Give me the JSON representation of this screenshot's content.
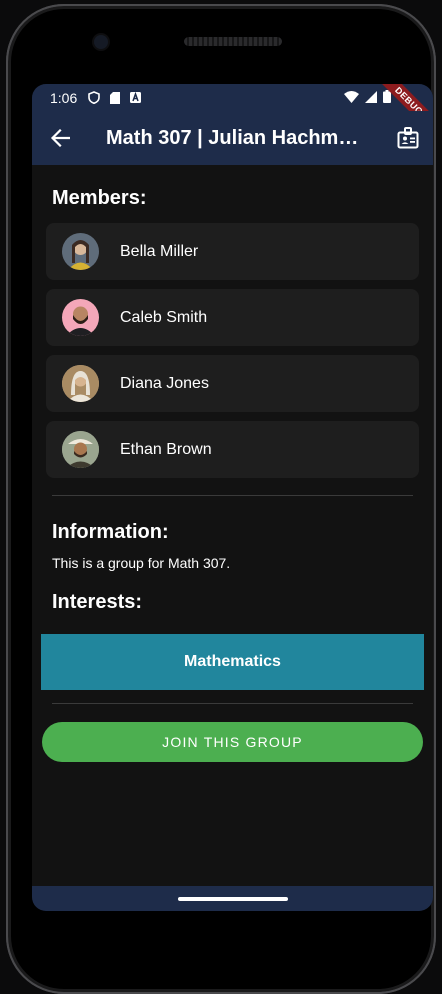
{
  "status_bar": {
    "time": "1:06",
    "debug_label": "DEBUG"
  },
  "app_bar": {
    "title": "Math 307 | Julian Hachme…"
  },
  "members": {
    "heading": "Members:",
    "items": [
      {
        "name": "Bella Miller",
        "avatar_color": "#6f7c8a"
      },
      {
        "name": "Caleb Smith",
        "avatar_color": "#f4a7b9"
      },
      {
        "name": "Diana Jones",
        "avatar_color": "#c9b08a"
      },
      {
        "name": "Ethan Brown",
        "avatar_color": "#8e9a86"
      }
    ]
  },
  "information": {
    "heading": "Information:",
    "text": "This is a group for Math 307."
  },
  "interests": {
    "heading": "Interests:",
    "items": [
      "Mathematics"
    ]
  },
  "join_button": {
    "label": "JOIN THIS GROUP"
  },
  "colors": {
    "app_bar": "#1e2c4a",
    "background": "#121212",
    "card": "#1e1e1e",
    "interest_chip": "#21869d",
    "join_button": "#4caf50"
  }
}
